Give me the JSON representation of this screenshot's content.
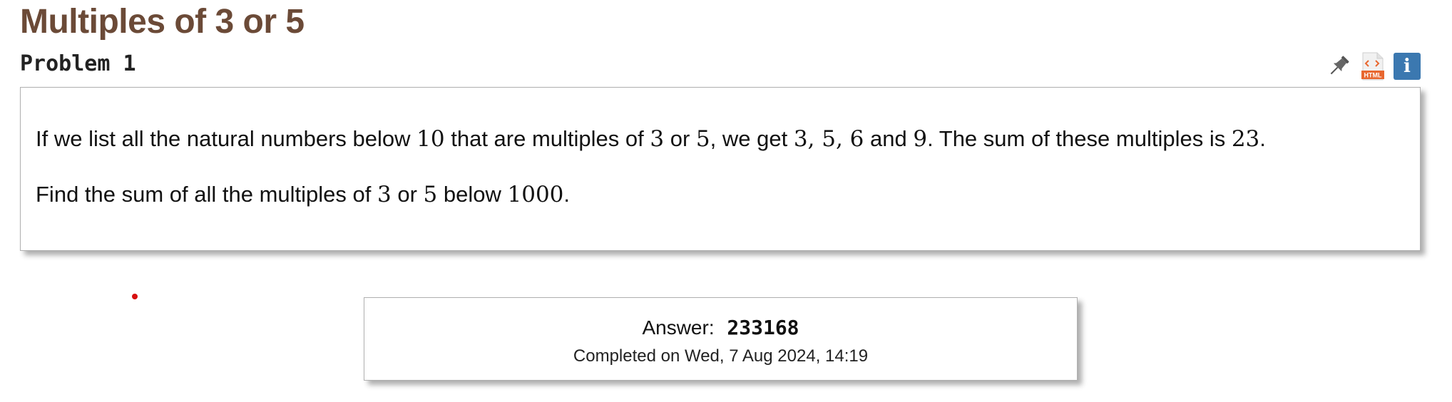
{
  "title": "Multiples of 3 or 5",
  "problem_number": "Problem 1",
  "icons": {
    "pin": "pin-icon",
    "html": "html-file-icon",
    "html_badge": "HTML",
    "info": "info-icon",
    "info_glyph": "i",
    "info_color": "#3b78b0",
    "html_color": "#e8672f"
  },
  "statement": {
    "p1": {
      "t1": "If we list all the natural numbers below ",
      "n1": "10",
      "t2": " that are multiples of ",
      "n2": "3",
      "t3": " or ",
      "n3": "5",
      "t4": ", we get ",
      "n4": "3, 5, 6",
      "t5": " and ",
      "n5": "9",
      "t6": ". The sum of these multiples is ",
      "n6": "23",
      "t7": "."
    },
    "p2": {
      "t1": "Find the sum of all the multiples of ",
      "n1": "3",
      "t2": " or ",
      "n2": "5",
      "t3": " below ",
      "n3": "1000",
      "t4": "."
    }
  },
  "answer": {
    "label": "Answer:",
    "value": "233168",
    "completed": "Completed on Wed, 7 Aug 2024, 14:19"
  },
  "colors": {
    "title": "#6b4a37",
    "marker_dot": "#d71010"
  }
}
